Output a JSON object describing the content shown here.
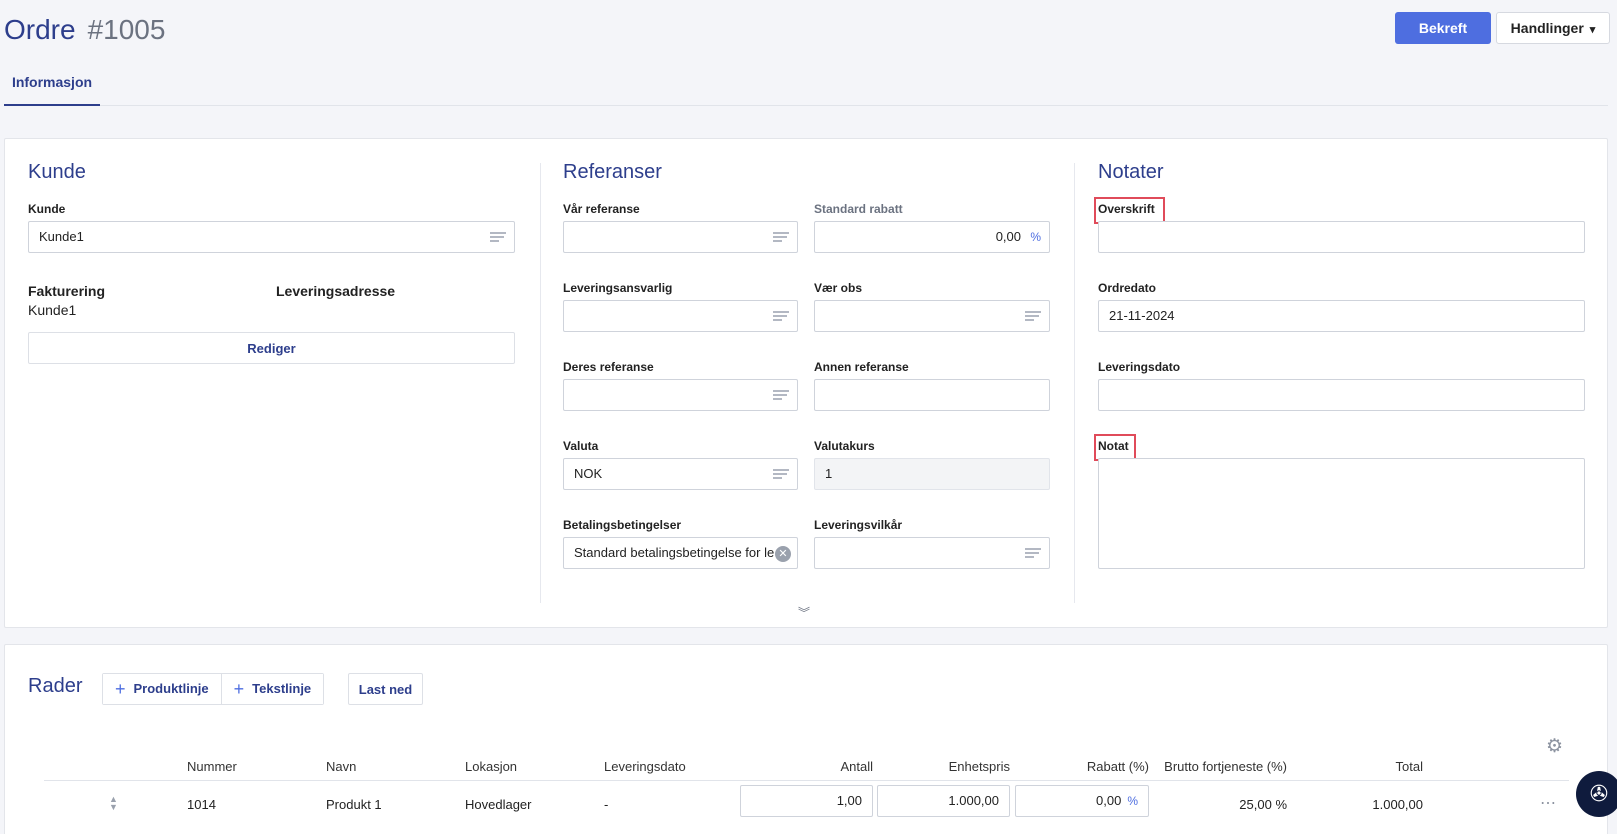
{
  "header": {
    "title": "Ordre",
    "number": "#1005",
    "confirm_label": "Bekreft",
    "actions_label": "Handlinger"
  },
  "tabs": [
    {
      "label": "Informasjon",
      "active": true
    }
  ],
  "customer": {
    "title": "Kunde",
    "customer_label": "Kunde",
    "customer_value": "Kunde1",
    "billing_label": "Fakturering",
    "billing_value": "Kunde1",
    "delivery_address_label": "Leveringsadresse",
    "edit_label": "Rediger"
  },
  "references": {
    "title": "Referanser",
    "our_reference_label": "Vår referanse",
    "our_reference_value": "",
    "standard_discount_label": "Standard rabatt",
    "standard_discount_value": "0,00",
    "percent": "%",
    "delivery_responsible_label": "Leveringsansvarlig",
    "attention_label": "Vær obs",
    "their_reference_label": "Deres referanse",
    "other_reference_label": "Annen referanse",
    "currency_label": "Valuta",
    "currency_value": "NOK",
    "exchange_rate_label": "Valutakurs",
    "exchange_rate_value": "1",
    "payment_terms_label": "Betalingsbetingelser",
    "payment_terms_value": "Standard betalingsbetingelse for le",
    "delivery_terms_label": "Leveringsvilkår"
  },
  "notes": {
    "title": "Notater",
    "heading_label": "Overskrift",
    "heading_value": "",
    "order_date_label": "Ordredato",
    "order_date_value": "21-11-2024",
    "delivery_date_label": "Leveringsdato",
    "delivery_date_value": "",
    "note_label": "Notat",
    "note_value": ""
  },
  "rows": {
    "title": "Rader",
    "add_product_line": "Produktlinje",
    "add_text_line": "Tekstlinje",
    "download_label": "Last ned",
    "columns": [
      "Nummer",
      "Navn",
      "Lokasjon",
      "Leveringsdato",
      "Antall",
      "Enhetspris",
      "Rabatt (%)",
      "Brutto fortjeneste (%)",
      "Total"
    ],
    "items": [
      {
        "number": "1014",
        "name": "Produkt 1",
        "location": "Hovedlager",
        "delivery_date": "-",
        "quantity": "1,00",
        "unit_price": "1.000,00",
        "discount": "0,00",
        "gross_profit": "25,00 %",
        "total": "1.000,00"
      }
    ]
  },
  "colors": {
    "accent": "#4e6ee0",
    "heading": "#2d3e8c",
    "highlight": "#e04b5a"
  },
  "icons": [
    "list-icon",
    "clear-icon",
    "expand-icon",
    "plus-icon",
    "gear-icon",
    "sort-icon",
    "more-icon",
    "support-icon",
    "chevron-down-icon"
  ]
}
